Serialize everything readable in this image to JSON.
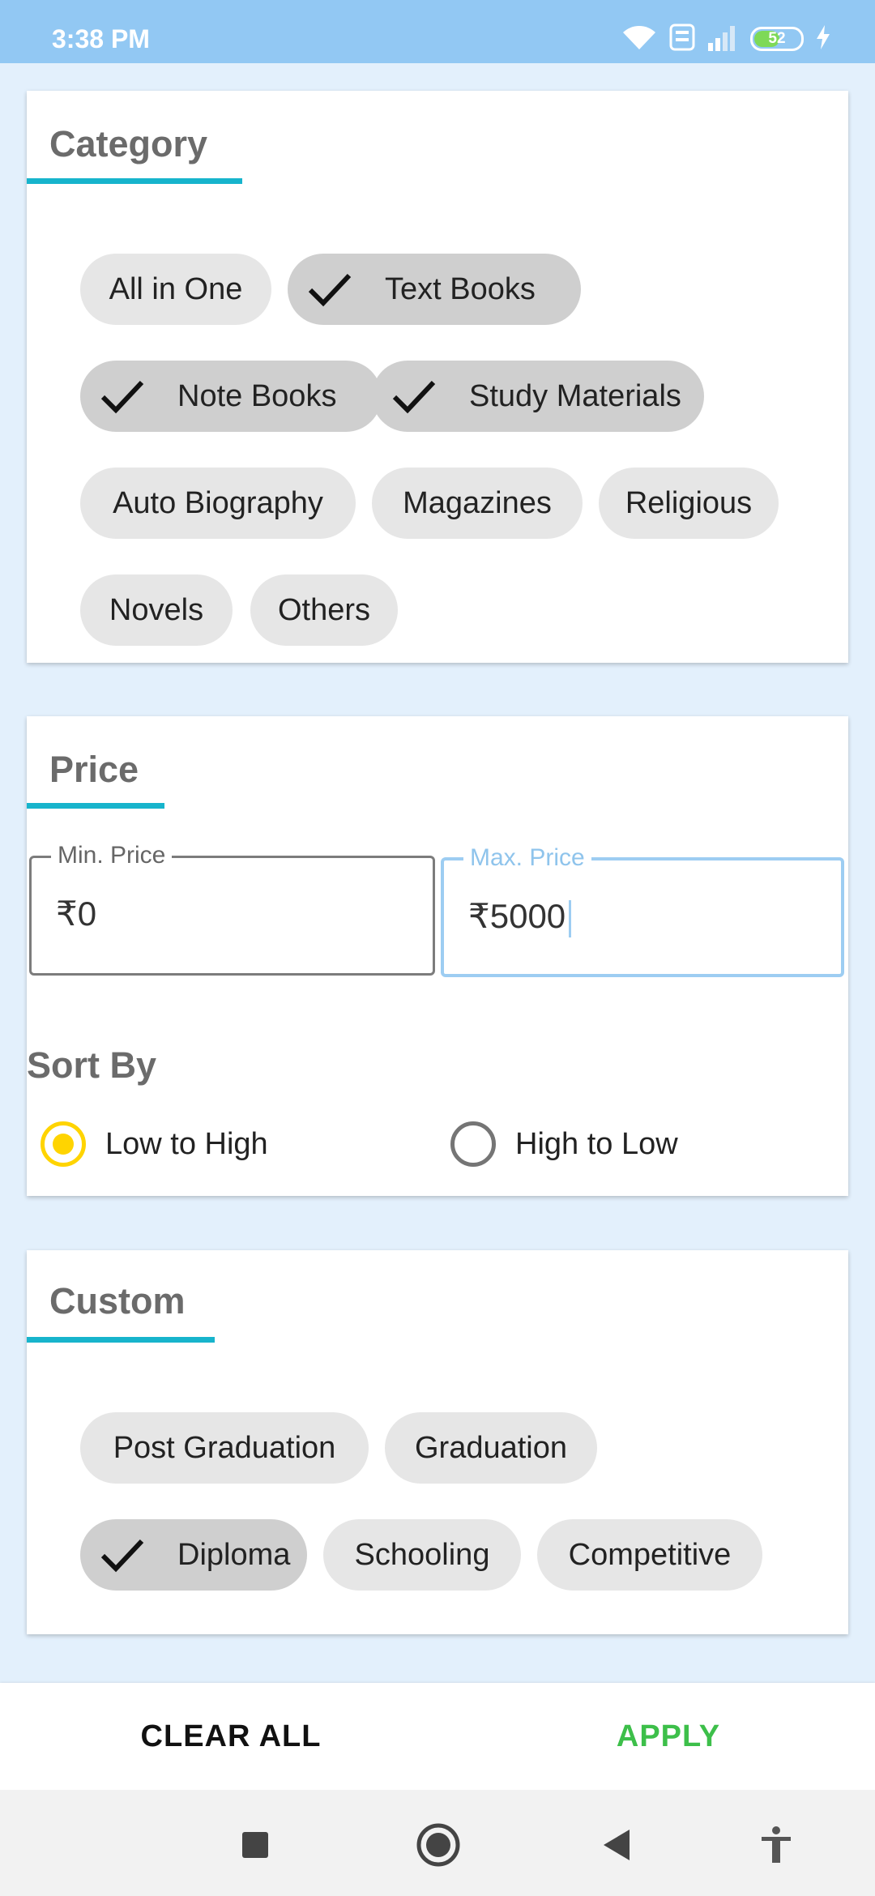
{
  "status_bar": {
    "time": "3:38 PM",
    "battery": "52",
    "icons": [
      "wifi-icon",
      "volte-icon",
      "signal-icon",
      "battery-icon",
      "charging-icon"
    ]
  },
  "category": {
    "title": "Category",
    "chips": [
      {
        "label": "All in One",
        "selected": false
      },
      {
        "label": "Text Books",
        "selected": true
      },
      {
        "label": "Note Books",
        "selected": true
      },
      {
        "label": "Study Materials",
        "selected": true
      },
      {
        "label": "Auto Biography",
        "selected": false
      },
      {
        "label": "Magazines",
        "selected": false
      },
      {
        "label": "Religious",
        "selected": false
      },
      {
        "label": "Novels",
        "selected": false
      },
      {
        "label": "Others",
        "selected": false
      }
    ]
  },
  "price": {
    "title": "Price",
    "min_label": "Min. Price",
    "min_value": "₹0",
    "max_label": "Max. Price",
    "max_value": "₹5000"
  },
  "sort": {
    "title": "Sort By",
    "options": [
      {
        "label": "Low to High",
        "selected": true
      },
      {
        "label": "High to Low",
        "selected": false
      }
    ]
  },
  "custom": {
    "title": "Custom",
    "chips": [
      {
        "label": "Post Graduation",
        "selected": false
      },
      {
        "label": "Graduation",
        "selected": false
      },
      {
        "label": "Diploma",
        "selected": true
      },
      {
        "label": "Schooling",
        "selected": false
      },
      {
        "label": "Competitive",
        "selected": false
      }
    ]
  },
  "actions": {
    "clear_label": "CLEAR ALL",
    "apply_label": "APPLY"
  },
  "colors": {
    "status_bar": "#92c8f3",
    "background": "#e3f0fc",
    "accent_underline": "#17b4cc",
    "radio_selected": "#ffd400",
    "apply": "#3dbf4a",
    "focused_field": "#9dcdf2"
  }
}
